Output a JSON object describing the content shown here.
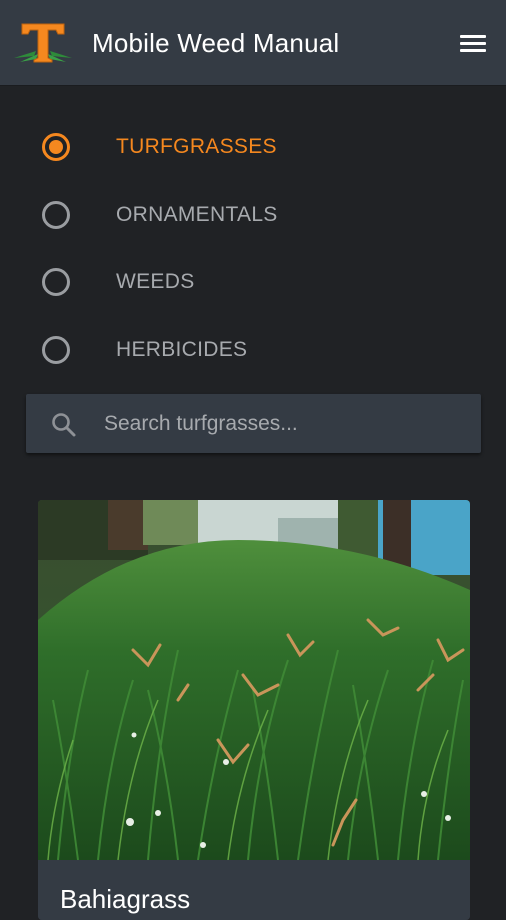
{
  "app_bar": {
    "title": "Mobile Weed Manual",
    "logo_icon": "tennessee-t-logo",
    "menu_icon": "hamburger-menu-icon"
  },
  "categories": [
    {
      "label": "TURFGRASSES",
      "selected": true
    },
    {
      "label": "ORNAMENTALS",
      "selected": false
    },
    {
      "label": "WEEDS",
      "selected": false
    },
    {
      "label": "HERBICIDES",
      "selected": false
    }
  ],
  "search": {
    "placeholder": "Search turfgrasses...",
    "value": "",
    "icon": "search-icon"
  },
  "results": [
    {
      "title": "Bahiagrass",
      "image": "bahiagrass-photo"
    }
  ],
  "colors": {
    "accent": "#f5881f",
    "background": "#202225",
    "surface": "#343b44",
    "text_muted": "#a7aaae",
    "text": "#ffffff"
  }
}
